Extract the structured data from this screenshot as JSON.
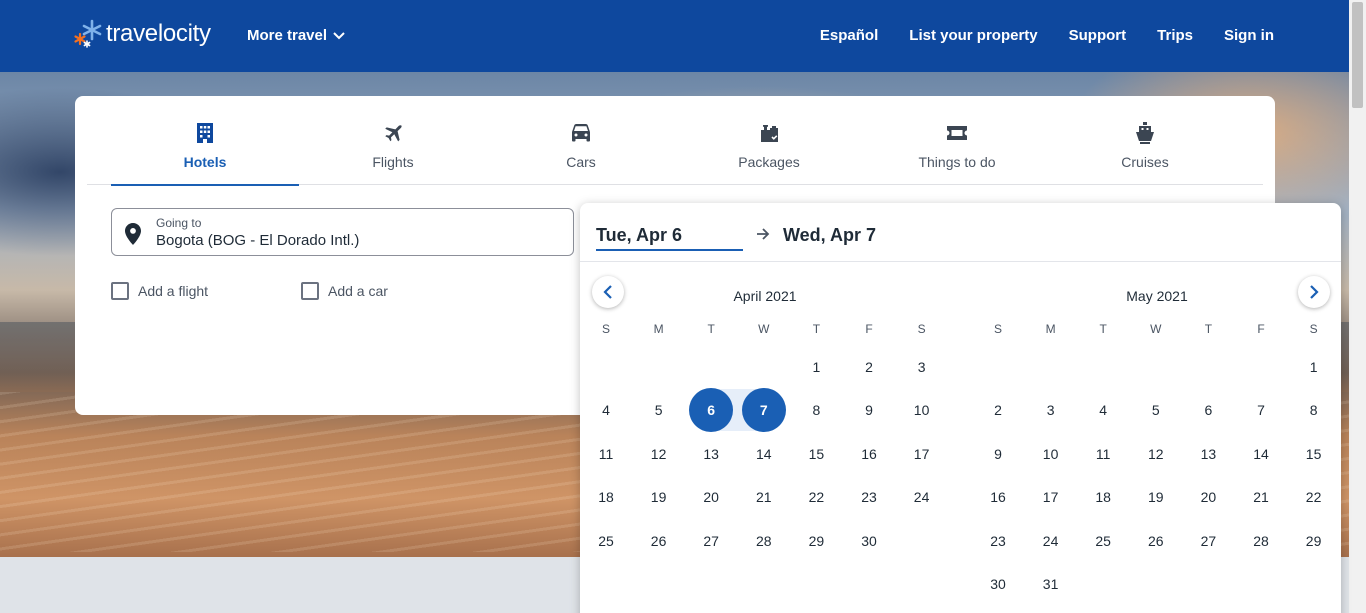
{
  "header": {
    "logo_text": "travelocity",
    "more_travel": "More travel",
    "nav": [
      "Español",
      "List your property",
      "Support",
      "Trips",
      "Sign in"
    ]
  },
  "tabs": [
    {
      "label": "Hotels",
      "icon": "building-icon",
      "active": true
    },
    {
      "label": "Flights",
      "icon": "airplane-icon",
      "active": false
    },
    {
      "label": "Cars",
      "icon": "car-icon",
      "active": false
    },
    {
      "label": "Packages",
      "icon": "luggage-icon",
      "active": false
    },
    {
      "label": "Things to do",
      "icon": "ticket-icon",
      "active": false
    },
    {
      "label": "Cruises",
      "icon": "ship-icon",
      "active": false
    }
  ],
  "search": {
    "going_to_label": "Going to",
    "going_to_value": "Bogota (BOG - El Dorado Intl.)",
    "add_flight": "Add a flight",
    "add_car": "Add a car"
  },
  "datepicker": {
    "start": "Tue, Apr 6",
    "end": "Wed, Apr 7",
    "weekdays": [
      "S",
      "M",
      "T",
      "W",
      "T",
      "F",
      "S"
    ],
    "months": [
      {
        "title": "April 2021",
        "first_weekday": 4,
        "days": 30,
        "selected": [
          6,
          7
        ]
      },
      {
        "title": "May 2021",
        "first_weekday": 6,
        "days": 31,
        "selected": []
      }
    ]
  },
  "colors": {
    "header": "#0e489e",
    "accent": "#1a5fb4"
  }
}
